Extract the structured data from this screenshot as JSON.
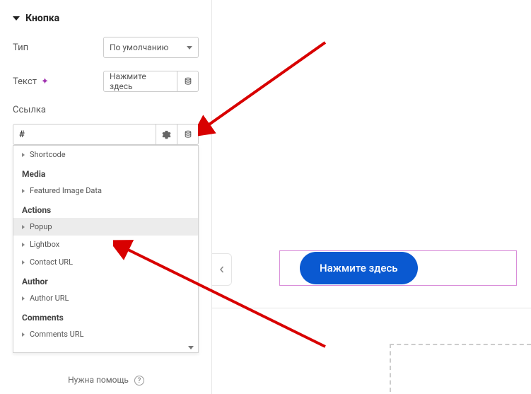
{
  "section": {
    "title": "Кнопка"
  },
  "fields": {
    "type": {
      "label": "Тип",
      "value": "По умолчанию"
    },
    "text": {
      "label": "Текст",
      "value": "Нажмите здесь"
    },
    "link": {
      "label": "Ссылка",
      "value": "#"
    }
  },
  "dropdown": {
    "items": [
      {
        "t": "item",
        "label": "Shortcode"
      },
      {
        "t": "heading",
        "label": "Media"
      },
      {
        "t": "item",
        "label": "Featured Image Data"
      },
      {
        "t": "heading",
        "label": "Actions"
      },
      {
        "t": "item",
        "label": "Popup",
        "hovered": true
      },
      {
        "t": "item",
        "label": "Lightbox"
      },
      {
        "t": "item",
        "label": "Contact URL"
      },
      {
        "t": "heading",
        "label": "Author"
      },
      {
        "t": "item",
        "label": "Author URL"
      },
      {
        "t": "heading",
        "label": "Comments"
      },
      {
        "t": "item",
        "label": "Comments URL"
      }
    ]
  },
  "footer": {
    "help": "Нужна помощь"
  },
  "canvas": {
    "button_label": "Нажмите здесь"
  },
  "icons": {
    "db": "database-icon",
    "gear": "gear-icon",
    "ai": "ai-sparkle-icon",
    "collapse": "chevron-left-icon"
  }
}
